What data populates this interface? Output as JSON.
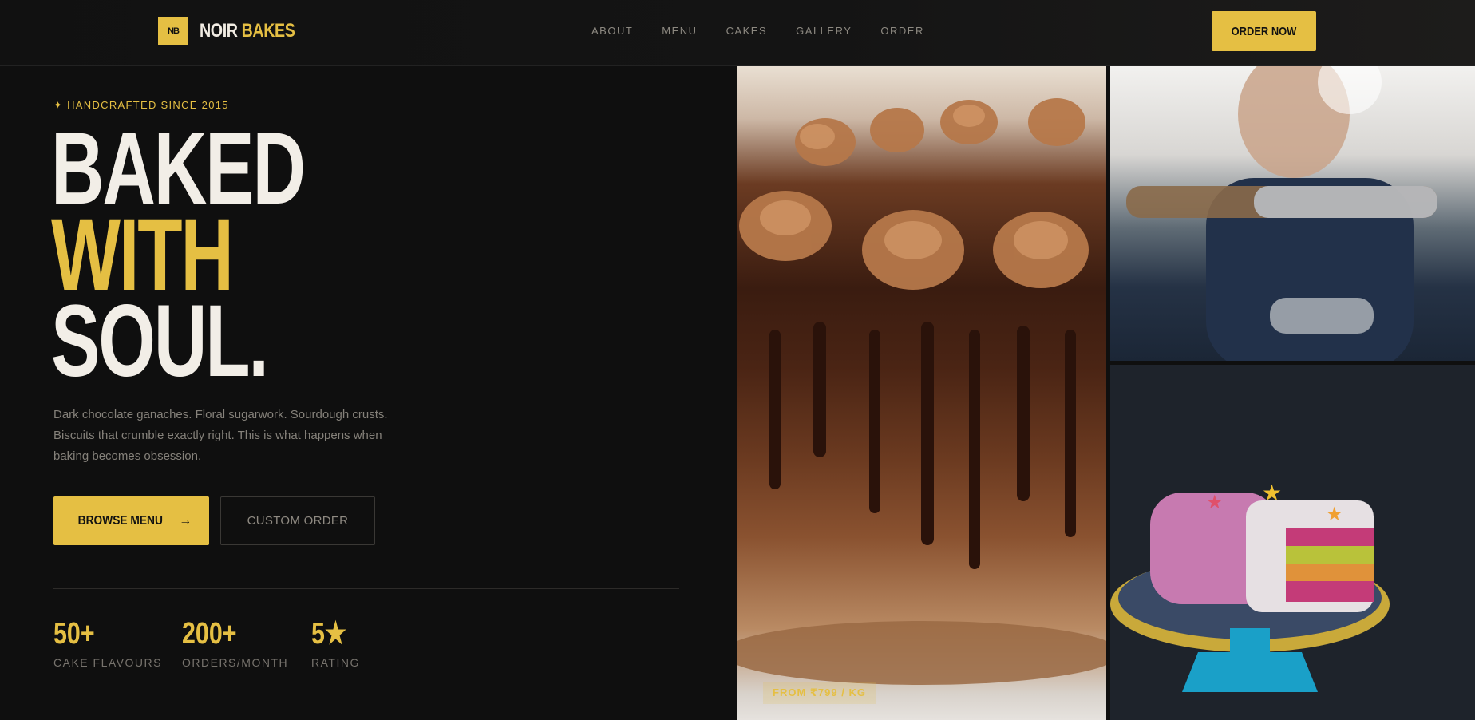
{
  "nav": {
    "logo_mark": "NB",
    "logo_word1": "NOIR",
    "logo_word2": "BAKES",
    "links": [
      "ABOUT",
      "MENU",
      "CAKES",
      "GALLERY",
      "ORDER"
    ],
    "cta": "ORDER NOW"
  },
  "hero": {
    "eyebrow": "✦ HANDCRAFTED SINCE 2015",
    "headline": [
      "BAKED",
      "WITH",
      "SOUL."
    ],
    "description": "Dark chocolate ganaches. Floral sugarwork. Sourdough crusts. Biscuits that crumble exactly right. This is what happens when baking becomes obsession.",
    "primary_button": "BROWSE MENU",
    "secondary_button": "CUSTOM ORDER",
    "stats": [
      {
        "value": "50+",
        "label": "CAKE FLAVOURS"
      },
      {
        "value": "200+",
        "label": "ORDERS/MONTH"
      },
      {
        "value": "5★",
        "label": "RATING"
      }
    ]
  },
  "gallery": {
    "price_tag": "FROM ₹799 / KG"
  },
  "colors": {
    "accent": "#e5bf43",
    "background": "#0f0f0f",
    "text_light": "#f2eee7",
    "text_muted": "#85817a"
  },
  "icons": {
    "primary_button_icon": "arrow-right-icon"
  }
}
